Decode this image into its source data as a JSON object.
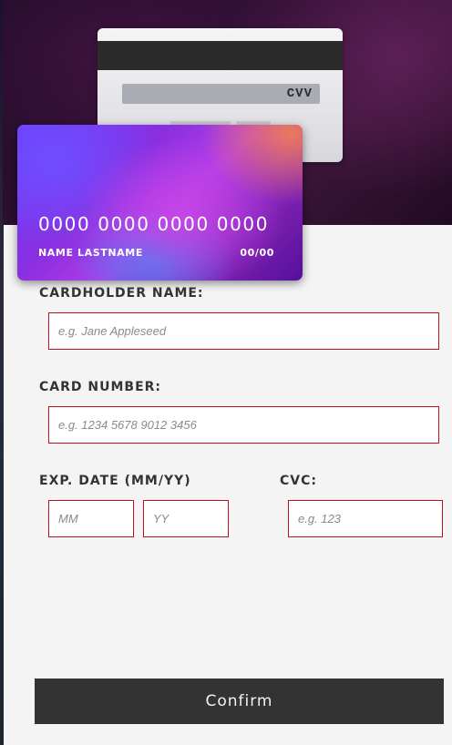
{
  "card_back": {
    "cvv_label": "CVV"
  },
  "card_front": {
    "number": "0000 0000 0000 0000",
    "name": "NAME LASTNAME",
    "expiry": "00/00"
  },
  "form": {
    "cardholder": {
      "label": "CARDHOLDER NAME:",
      "placeholder": "e.g. Jane Appleseed",
      "value": ""
    },
    "card_number": {
      "label": "CARD NUMBER:",
      "placeholder": "e.g. 1234 5678 9012 3456",
      "value": ""
    },
    "exp_date": {
      "label": "EXP. DATE (MM/YY)",
      "month_placeholder": "MM",
      "year_placeholder": "YY"
    },
    "cvc": {
      "label": "CVC:",
      "placeholder": "e.g. 123"
    },
    "confirm_label": "Confirm"
  },
  "colors": {
    "error_border": "#c0101a",
    "button_bg": "#333333",
    "page_bg": "#f4f4f4"
  }
}
